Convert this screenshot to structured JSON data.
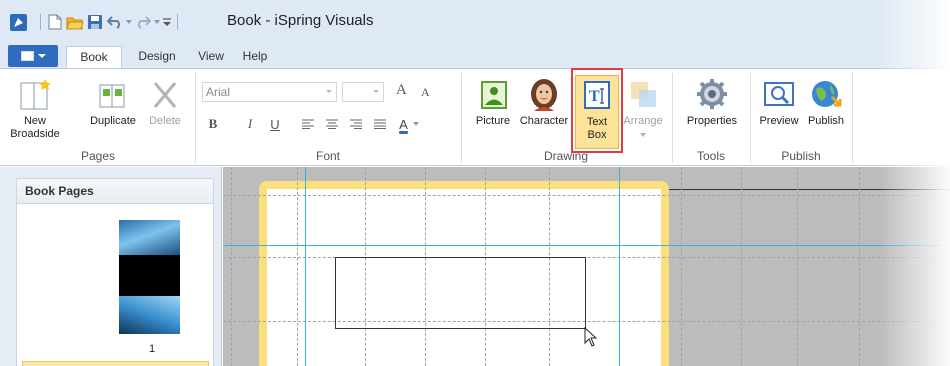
{
  "window": {
    "title": "Book - iSpring Visuals"
  },
  "tabs": [
    {
      "label": "Book",
      "active": true
    },
    {
      "label": "Design",
      "active": false
    },
    {
      "label": "View",
      "active": false
    },
    {
      "label": "Help",
      "active": false
    }
  ],
  "ribbon": {
    "pages": {
      "group_label": "Pages",
      "new_broadside": "New\nBroadside",
      "duplicate": "Duplicate",
      "delete": "Delete"
    },
    "font": {
      "group_label": "Font",
      "font_name": "Arial",
      "font_size": "",
      "bold": "B",
      "italic": "I",
      "underline": "U",
      "grow_icon": "A",
      "shrink_icon": "A",
      "color_icon": "A"
    },
    "drawing": {
      "group_label": "Drawing",
      "picture": "Picture",
      "character": "Character",
      "text_box": "Text\nBox",
      "arrange": "Arrange"
    },
    "tools": {
      "group_label": "Tools",
      "properties": "Properties"
    },
    "publish": {
      "group_label": "Publish",
      "preview": "Preview",
      "publish": "Publish"
    }
  },
  "panel": {
    "header": "Book Pages",
    "page_number": "1"
  },
  "colors": {
    "titlebar_bg": "#dfe9f5",
    "accent_blue": "#2f6cc0",
    "highlight_red": "#e23b44",
    "page_border_yellow": "#fcdf7d",
    "guide_blue": "#3ab0e0"
  }
}
